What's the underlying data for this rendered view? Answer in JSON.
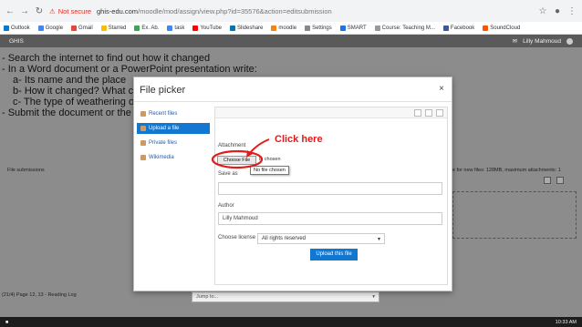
{
  "browser": {
    "warning": "Not secure",
    "url_host": "ghis-edu.com",
    "url_path": "/moodle/mod/assign/view.php?id=35576&action=editsubmission",
    "bookmarks": [
      "Outlook",
      "Google",
      "Gmail",
      "Starred",
      "Ex. Ab.",
      "task",
      "YouTube",
      "Slideshare",
      "moodle",
      "Settings",
      "SMART",
      "Course: Teaching M...",
      "Facebook",
      "SoundCloud"
    ]
  },
  "header": {
    "site": "GHIS",
    "user": "Lilly Mahmoud"
  },
  "page": {
    "lines": [
      "- Search the internet to find out how it changed",
      "- In a Word document or a PowerPoint presentation write:",
      "a- Its name and the place",
      "b- How it changed? What ca",
      "c- The type of weathering or",
      "- Submit the document or the p"
    ],
    "file_submissions": "File submissions",
    "size_note": "um size for new files: 128MB, maximum attachments: 1",
    "footer_left": "(21/4) Page 12, 13 - Reading Log",
    "jump_to": "Jump to..."
  },
  "dialog": {
    "title": "File picker",
    "close": "×",
    "repos": [
      {
        "label": "Recent files",
        "active": false
      },
      {
        "label": "Upload a file",
        "active": true
      },
      {
        "label": "Private files",
        "active": false
      },
      {
        "label": "Wikimedia",
        "active": false
      }
    ],
    "attachment_label": "Attachment",
    "choose_file": "Choose File",
    "no_file_partial": "le chosen",
    "tooltip": "No file chosen",
    "save_as_label": "Save as",
    "author_label": "Author",
    "author_value": "Lilly Mahmoud",
    "license_label": "Choose license",
    "license_value": "All rights reserved",
    "upload_button": "Upload this file"
  },
  "annotation": {
    "text": "Click here",
    "color": "#e01b1b"
  },
  "taskbar": {
    "time": "10:33 AM"
  }
}
